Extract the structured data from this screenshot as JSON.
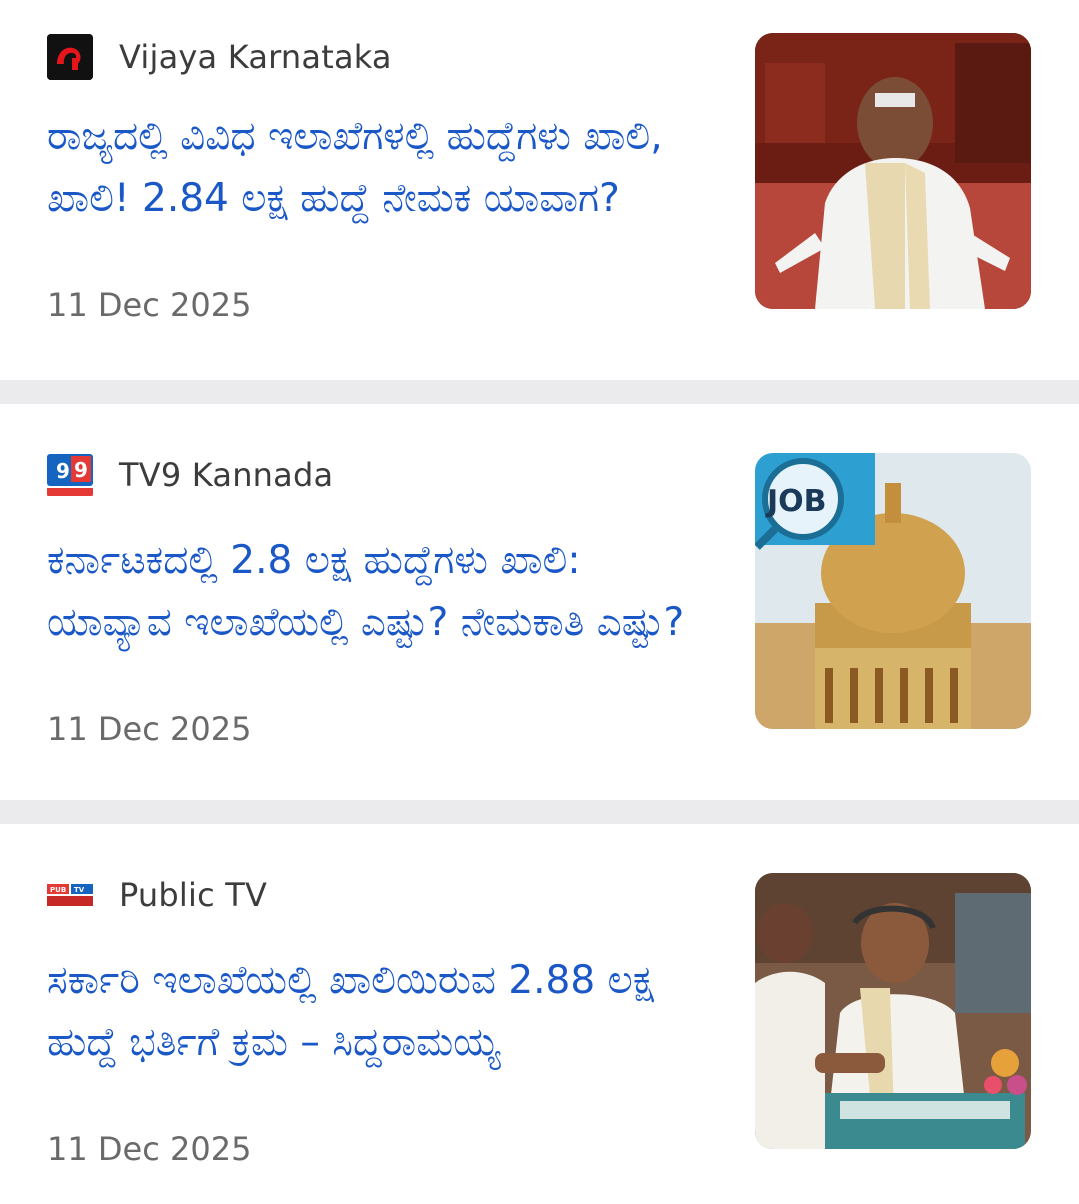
{
  "articles": [
    {
      "source": "Vijaya Karnataka",
      "source_logo_icon": "vijaya-karnataka-logo",
      "headline": "ರಾಜ್ಯದಲ್ಲಿ ವಿವಿಧ ಇಲಾಖೆಗಳಲ್ಲಿ ಹುದ್ದೆಗಳು ಖಾಲಿ, ಖಾಲಿ! 2.84 ಲಕ್ಷ ಹುದ್ದೆ ನೇಮಕ ಯಾವಾಗ?",
      "date": "11 Dec 2025",
      "thumbnail": "politician-in-assembly-photo"
    },
    {
      "source": "TV9 Kannada",
      "source_logo_icon": "tv9-logo",
      "headline": "ಕರ್ನಾಟಕದಲ್ಲಿ 2.8 ಲಕ್ಷ ಹುದ್ದೆಗಳು ಖಾಲಿ: ಯಾವ್ಯಾವ ಇಲಾಖೆಯಲ್ಲಿ ಎಷ್ಟು? ನೇಮಕಾತಿ ಎಷ್ಟು?",
      "date": "11 Dec 2025",
      "thumbnail": "vidhana-soudha-job-photo",
      "thumbnail_badge": "JOB"
    },
    {
      "source": "Public TV",
      "source_logo_icon": "public-tv-logo",
      "headline": "ಸರ್ಕಾರಿ ಇಲಾಖೆಯಲ್ಲಿ ಖಾಲಿಯಿರುವ 2.88 ಲಕ್ಷ ಹುದ್ದೆ ಭರ್ತಿಗೆ ಕ್ರಮ – ಸಿದ್ದರಾಮಯ್ಯ",
      "date": "11 Dec 2025",
      "thumbnail": "speaker-at-podium-photo"
    }
  ],
  "colors": {
    "headline": "#1a57c7",
    "source": "#3c3c3c",
    "date": "#6a6a6a",
    "separator": "#ebebee"
  }
}
